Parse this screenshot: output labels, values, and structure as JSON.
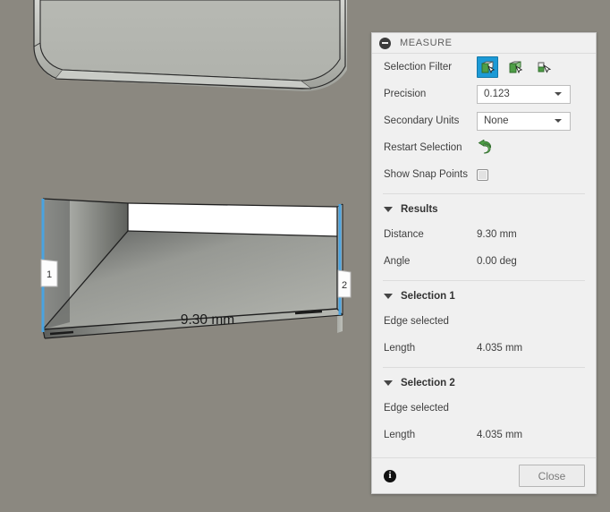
{
  "viewport": {
    "background_color": "#8b8880",
    "dimension_label": "9.30 mm",
    "edge_marker_1": "1",
    "edge_marker_2": "2",
    "highlight_color": "#4aa3e0",
    "face_light": "#b4b6b0",
    "face_white": "#ffffff"
  },
  "panel": {
    "title": "MEASURE",
    "collapse_icon": "minus-circle-icon",
    "selection_filter": {
      "label": "Selection Filter",
      "options": [
        {
          "name": "select-face-icon",
          "active": true
        },
        {
          "name": "select-body-icon",
          "active": false
        },
        {
          "name": "select-vertex-icon",
          "active": false
        }
      ]
    },
    "precision": {
      "label": "Precision",
      "value": "0.123"
    },
    "secondary_units": {
      "label": "Secondary Units",
      "value": "None"
    },
    "restart_selection": {
      "label": "Restart Selection",
      "icon": "restart-arrow-icon"
    },
    "show_snap_points": {
      "label": "Show Snap Points",
      "checked": false
    },
    "results": {
      "header": "Results",
      "rows": [
        {
          "label": "Distance",
          "value": "9.30 mm"
        },
        {
          "label": "Angle",
          "value": "0.00 deg"
        }
      ]
    },
    "selection_1": {
      "header": "Selection 1",
      "status": "Edge selected",
      "rows": [
        {
          "label": "Length",
          "value": "4.035 mm"
        }
      ]
    },
    "selection_2": {
      "header": "Selection 2",
      "status": "Edge selected",
      "rows": [
        {
          "label": "Length",
          "value": "4.035 mm"
        }
      ]
    },
    "footer": {
      "info_icon": "info-icon",
      "info_glyph": "i",
      "close_label": "Close"
    }
  }
}
